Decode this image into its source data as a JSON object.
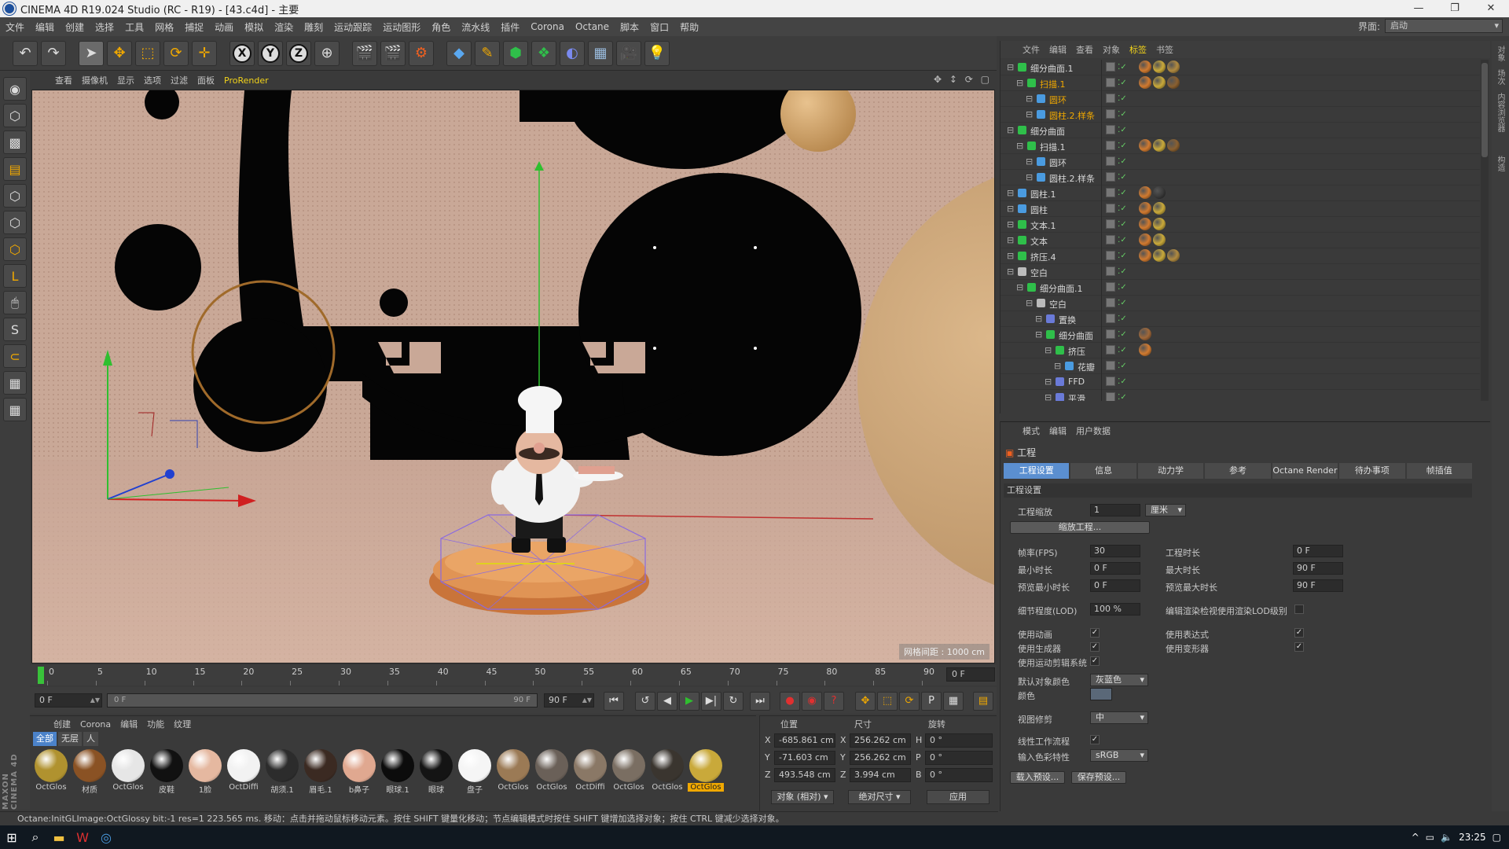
{
  "window": {
    "title": "CINEMA 4D R19.024 Studio (RC - R19) - [43.c4d] - 主要",
    "controls": [
      "—",
      "❐",
      "✕"
    ]
  },
  "menubar": {
    "items": [
      "文件",
      "编辑",
      "创建",
      "选择",
      "工具",
      "网格",
      "捕捉",
      "动画",
      "模拟",
      "渲染",
      "雕刻",
      "运动跟踪",
      "运动图形",
      "角色",
      "流水线",
      "插件",
      "Corona",
      "Octane",
      "脚本",
      "窗口",
      "帮助"
    ],
    "layout_label": "界面:",
    "layout_value": "启动"
  },
  "viewport": {
    "menu": [
      "查看",
      "摄像机",
      "显示",
      "选项",
      "过滤",
      "面板",
      "ProRender"
    ],
    "grid_label": "网格间距 : 1000 cm"
  },
  "timeline": {
    "ticks": [
      "0",
      "5",
      "10",
      "15",
      "20",
      "25",
      "30",
      "35",
      "40",
      "45",
      "50",
      "55",
      "60",
      "65",
      "70",
      "75",
      "80",
      "85",
      "90"
    ],
    "current_frame": "0 F"
  },
  "transport": {
    "start_field": "0 F",
    "slider_left": "0 F",
    "slider_right": "90 F",
    "end_field": "90 F"
  },
  "material_manager": {
    "menu": [
      "创建",
      "Corona",
      "编辑",
      "功能",
      "纹理"
    ],
    "filters": [
      "全部",
      "无层",
      "人"
    ],
    "materials": [
      {
        "name": "OctGlos",
        "color": "#b0922f"
      },
      {
        "name": "材质",
        "color": "#8a5224"
      },
      {
        "name": "OctGlos",
        "color": "#e6e6e6"
      },
      {
        "name": "皮鞋",
        "color": "#111111"
      },
      {
        "name": "1脸",
        "color": "#e5b8a0"
      },
      {
        "name": "OctDiffi",
        "color": "#f2f2f2"
      },
      {
        "name": "胡须.1",
        "color": "#2c2c2c"
      },
      {
        "name": "眉毛.1",
        "color": "#3b2a22"
      },
      {
        "name": "b鼻子",
        "color": "#e0a890"
      },
      {
        "name": "眼球.1",
        "color": "#0c0c0c"
      },
      {
        "name": "眼球",
        "color": "#141414"
      },
      {
        "name": "盘子",
        "color": "#f5f5f5"
      },
      {
        "name": "OctGlos",
        "color": "#9b7a55"
      },
      {
        "name": "OctGlos",
        "color": "#6a6058"
      },
      {
        "name": "OctDiffi",
        "color": "#8a7866"
      },
      {
        "name": "OctGlos",
        "color": "#7a6e62"
      },
      {
        "name": "OctGlos",
        "color": "#3a352f"
      },
      {
        "name": "OctGlos",
        "color": "#c9a93a"
      }
    ]
  },
  "coordinates": {
    "headers": [
      "位置",
      "尺寸",
      "旋转"
    ],
    "rows": [
      {
        "axis": "X",
        "pos": "-685.861 cm",
        "size_axis": "X",
        "size": "256.262 cm",
        "rot_axis": "H",
        "rot": "0 °"
      },
      {
        "axis": "Y",
        "pos": "-71.603 cm",
        "size_axis": "Y",
        "size": "256.262 cm",
        "rot_axis": "P",
        "rot": "0 °"
      },
      {
        "axis": "Z",
        "pos": "493.548 cm",
        "size_axis": "Z",
        "size": "3.994 cm",
        "rot_axis": "B",
        "rot": "0 °"
      }
    ],
    "mode_button": "对象 (相对)",
    "size_button": "绝对尺寸",
    "apply_button": "应用"
  },
  "status_text": "Octane:InitGLImage:OctGlossy  bit:-1 res=1  223.565 ms.     移动：点击并拖动鼠标移动元素。按住 SHIFT 键量化移动；节点编辑模式时按住 SHIFT 键增加选择对象；按住 CTRL 键减少选择对象。",
  "object_manager": {
    "menu": [
      "文件",
      "编辑",
      "查看",
      "对象",
      "标签",
      "书签"
    ],
    "active_menu": "标签",
    "objects": [
      {
        "name": "细分曲面.1",
        "indent": 0,
        "icon": "#2fbf4a",
        "sel": false,
        "tags": [
          "#d07a30",
          "#c9a93a",
          "#b08a40"
        ]
      },
      {
        "name": "扫描.1",
        "indent": 1,
        "icon": "#2fbf4a",
        "sel": true,
        "tags": [
          "#d07a30",
          "#c9a93a",
          "#8a6030"
        ]
      },
      {
        "name": "圆环",
        "indent": 2,
        "icon": "#4a9be0",
        "sel": true,
        "tags": []
      },
      {
        "name": "圆柱.2.样条",
        "indent": 2,
        "icon": "#4a9be0",
        "sel": true,
        "tags": []
      },
      {
        "name": "细分曲面",
        "indent": 0,
        "icon": "#2fbf4a",
        "sel": false,
        "tags": []
      },
      {
        "name": "扫描.1",
        "indent": 1,
        "icon": "#2fbf4a",
        "sel": false,
        "tags": [
          "#d07a30",
          "#c9a93a",
          "#8a6030"
        ]
      },
      {
        "name": "圆环",
        "indent": 2,
        "icon": "#4a9be0",
        "sel": false,
        "tags": []
      },
      {
        "name": "圆柱.2.样条",
        "indent": 2,
        "icon": "#4a9be0",
        "sel": false,
        "tags": []
      },
      {
        "name": "圆柱.1",
        "indent": 0,
        "icon": "#4a9be0",
        "sel": false,
        "tags": [
          "#d07a30",
          "#3a3a3a"
        ]
      },
      {
        "name": "圆柱",
        "indent": 0,
        "icon": "#4a9be0",
        "sel": false,
        "tags": [
          "#d07a30",
          "#c9a93a"
        ]
      },
      {
        "name": "文本.1",
        "indent": 0,
        "icon": "#2fbf4a",
        "sel": false,
        "tags": [
          "#d07a30",
          "#c9a93a"
        ]
      },
      {
        "name": "文本",
        "indent": 0,
        "icon": "#2fbf4a",
        "sel": false,
        "tags": [
          "#d07a30",
          "#c9a93a"
        ]
      },
      {
        "name": "挤压.4",
        "indent": 0,
        "icon": "#2fbf4a",
        "sel": false,
        "tags": [
          "#d07a30",
          "#c9a93a",
          "#b08a40"
        ]
      },
      {
        "name": "空白",
        "indent": 0,
        "icon": "#bbbbbb",
        "sel": false,
        "tags": []
      },
      {
        "name": "细分曲面.1",
        "indent": 1,
        "icon": "#2fbf4a",
        "sel": false,
        "tags": []
      },
      {
        "name": "空白",
        "indent": 2,
        "icon": "#bbbbbb",
        "sel": false,
        "tags": []
      },
      {
        "name": "置换",
        "indent": 3,
        "icon": "#6a7ad8",
        "sel": false,
        "tags": []
      },
      {
        "name": "细分曲面",
        "indent": 3,
        "icon": "#2fbf4a",
        "sel": false,
        "tags": [
          "#a0683a"
        ]
      },
      {
        "name": "挤压",
        "indent": 4,
        "icon": "#2fbf4a",
        "sel": false,
        "tags": [
          "#d07a30"
        ]
      },
      {
        "name": "花瓣",
        "indent": 5,
        "icon": "#4a9be0",
        "sel": false,
        "tags": []
      },
      {
        "name": "FFD",
        "indent": 4,
        "icon": "#6a7ad8",
        "sel": false,
        "tags": []
      },
      {
        "name": "平滑",
        "indent": 4,
        "icon": "#6a7ad8",
        "sel": false,
        "tags": []
      }
    ]
  },
  "attribute_manager": {
    "menu": [
      "模式",
      "编辑",
      "用户数据"
    ],
    "object": "工程",
    "tabs": [
      "工程设置",
      "信息",
      "动力学",
      "参考",
      "Octane Render",
      "待办事项",
      "帧插值"
    ],
    "section": "工程设置",
    "project_scale_label": "工程缩放",
    "project_scale": "1",
    "project_scale_unit": "厘米",
    "scale_button": "缩放工程...",
    "fps_label": "帧率(FPS)",
    "fps": "30",
    "project_time_label": "工程时长",
    "project_time": "0 F",
    "min_time_label": "最小时长",
    "min_time": "0 F",
    "max_time_label": "最大时长",
    "max_time": "90 F",
    "preview_min_label": "预览最小时长",
    "preview_min": "0 F",
    "preview_max_label": "预览最大时长",
    "preview_max": "90 F",
    "lod_label": "细节程度(LOD)",
    "lod": "100 %",
    "lod_check_label": "编辑渲染检视使用渲染LOD级别",
    "use_anim_label": "使用动画",
    "use_expr_label": "使用表达式",
    "use_gen_label": "使用生成器",
    "use_deform_label": "使用变形器",
    "use_motion_label": "使用运动剪辑系统",
    "default_color_label": "默认对象颜色",
    "default_color": "灰蓝色",
    "color_label": "颜色",
    "view_clip_label": "视图修剪",
    "view_clip": "中",
    "linear_label": "线性工作流程",
    "input_color_label": "输入色彩特性",
    "input_color": "sRGB",
    "load_preset": "载入预设...",
    "save_preset": "保存预设..."
  },
  "right_tabs": [
    "对象",
    "场次",
    "内容浏览器",
    "构造"
  ],
  "taskbar": {
    "time": "23:25"
  }
}
